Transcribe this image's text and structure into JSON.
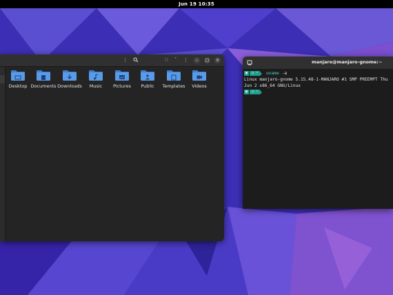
{
  "topbar": {
    "clock": "Jun 19  10:35"
  },
  "files": {
    "folders": [
      {
        "label": "Desktop",
        "icon": "desktop-folder-icon"
      },
      {
        "label": "Documents",
        "icon": "documents-folder-icon"
      },
      {
        "label": "Downloads",
        "icon": "downloads-folder-icon"
      },
      {
        "label": "Music",
        "icon": "music-folder-icon"
      },
      {
        "label": "Pictures",
        "icon": "pictures-folder-icon"
      },
      {
        "label": "Public",
        "icon": "public-folder-icon"
      },
      {
        "label": "Templates",
        "icon": "templates-folder-icon"
      },
      {
        "label": "Videos",
        "icon": "videos-folder-icon"
      }
    ],
    "colors": {
      "folder": "#5a9be8",
      "folder_dark": "#3f7fd0"
    }
  },
  "terminal": {
    "title": "manjaro@manjaro-gnome:~",
    "command": "uname",
    "command_arg": "-a",
    "output": "Linux manjaro-gnome 5.15.48-1-MANJARO #1 SMP PREEMPT Thu Jun 2 x86_64 GNU/Linux",
    "prompt_segment_1": "▣",
    "prompt_segment_2": "⌂ ~",
    "colors": {
      "prompt": "#1f9f8f",
      "command": "#4fd1c5"
    }
  },
  "colors": {
    "wallpaper_base": "#3f2fb8",
    "window_bg": "#242424",
    "header_bg": "#303030"
  }
}
